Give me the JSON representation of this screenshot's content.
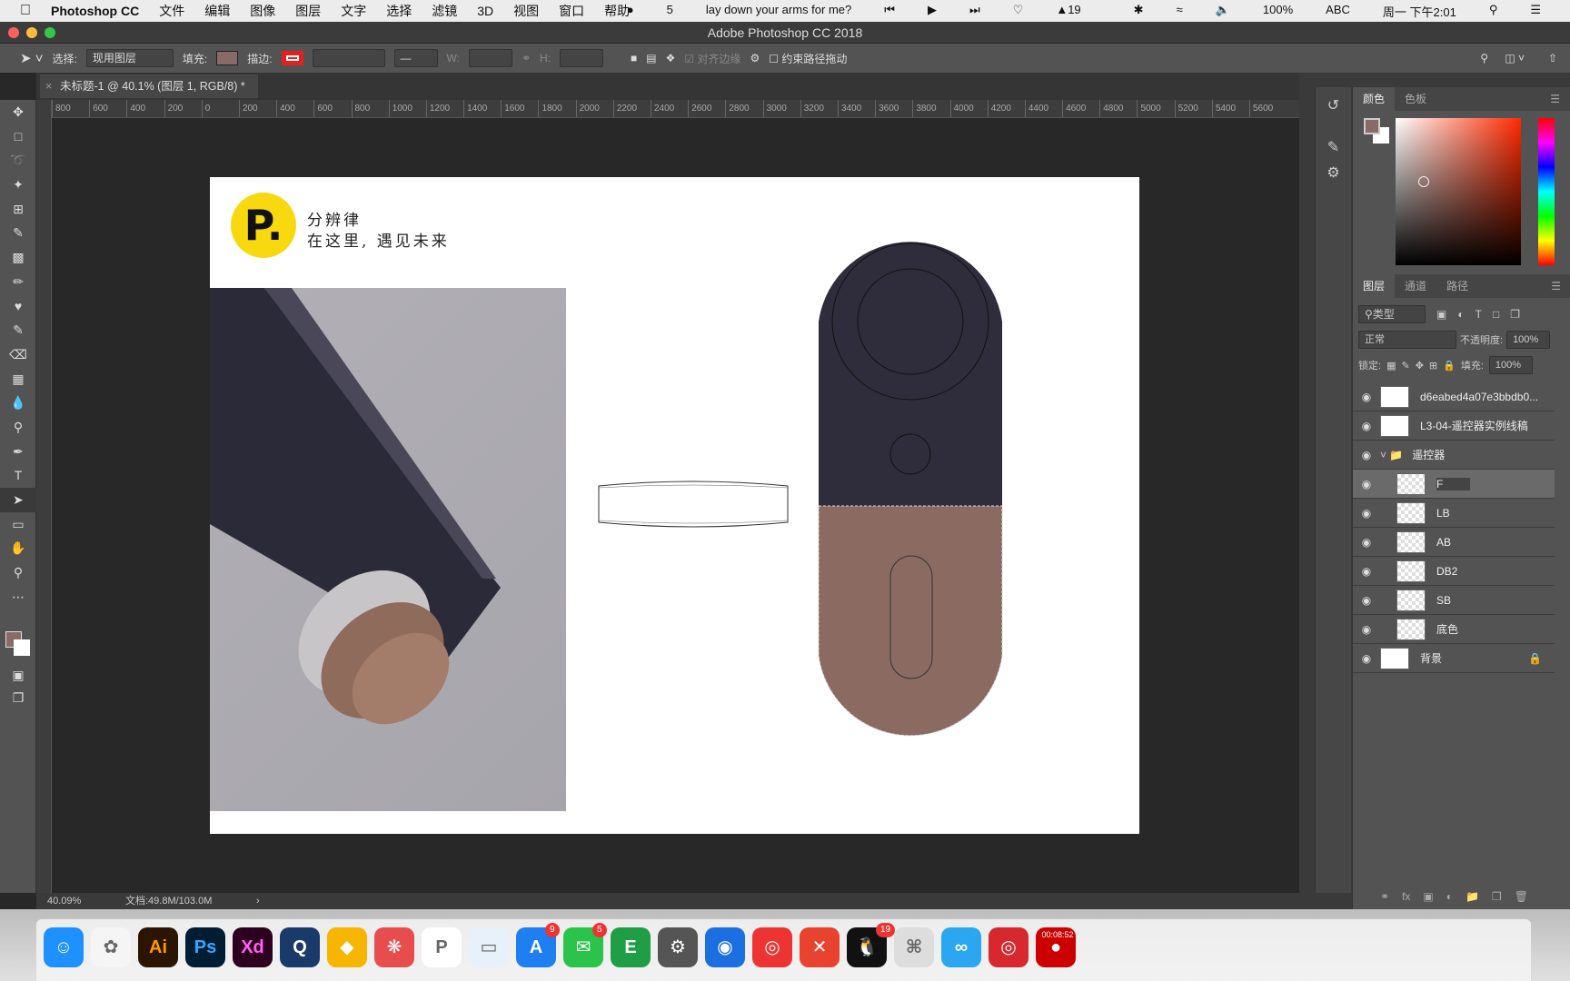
{
  "menubar": {
    "app": "Photoshop CC",
    "items": [
      "文件",
      "编辑",
      "图像",
      "图层",
      "文字",
      "选择",
      "滤镜",
      "3D",
      "视图",
      "窗口",
      "帮助"
    ],
    "wechat_count": "5",
    "song": "lay down your arms for me?",
    "notif_count": "19",
    "battery": "100%",
    "input": "ABC",
    "clock": "周一 下午2:01"
  },
  "window": {
    "title": "Adobe Photoshop CC 2018"
  },
  "options": {
    "select_label": "选择:",
    "select_value": "现用图层",
    "fill_label": "填充:",
    "stroke_label": "描边:",
    "w_label": "W:",
    "h_label": "H:",
    "align_edges": "对齐边缘",
    "constrain": "约束路径拖动",
    "fill_color": "#8a6a66",
    "stroke_color": "#e0211f"
  },
  "document": {
    "tab": "未标题-1 @ 40.1% (图层 1, RGB/8) *",
    "ruler": [
      "800",
      "600",
      "400",
      "200",
      "0",
      "200",
      "400",
      "600",
      "800",
      "1000",
      "1200",
      "1400",
      "1600",
      "1800",
      "2000",
      "2200",
      "2400",
      "2600",
      "2800",
      "3000",
      "3200",
      "3400",
      "3600",
      "3800",
      "4000",
      "4200",
      "4400",
      "4600",
      "4800",
      "5000",
      "5200",
      "5400",
      "5600"
    ],
    "logo_line1": "分辨律",
    "logo_line2": "在这里, 遇见未来",
    "logo_letter": "P."
  },
  "status": {
    "zoom": "40.09%",
    "doc": "文档:49.8M/103.0M"
  },
  "color_panel": {
    "tabs": [
      "颜色",
      "色板"
    ],
    "foreground": "#8a6a66",
    "background": "#ffffff"
  },
  "layers_panel": {
    "tabs": [
      "图层",
      "通道",
      "路径"
    ],
    "filter": "类型",
    "blend": "正常",
    "opacity_label": "不透明度:",
    "opacity": "100%",
    "lock_label": "锁定:",
    "fill_label": "填充:",
    "fill": "100%",
    "layers": [
      {
        "name": "d6eabed4a07e3bbdb0..."
      },
      {
        "name": "L3-04-遥控器实例线稿"
      },
      {
        "name": "遥控器",
        "group": true
      },
      {
        "name": "F",
        "selected": true
      },
      {
        "name": "LB"
      },
      {
        "name": "AB"
      },
      {
        "name": "DB2"
      },
      {
        "name": "SB"
      },
      {
        "name": "底色"
      },
      {
        "name": "背景",
        "locked": true
      }
    ]
  },
  "dock": {
    "apps": [
      "Finder",
      "Photos",
      "Ai",
      "Ps",
      "Xd",
      "QuickTime",
      "Sketch",
      "Klokki",
      "PicGo",
      "Keynote",
      "App Store",
      "WeChat",
      "Evernote",
      "System Preferences",
      "Safari",
      "Chrome",
      "XMind",
      "QQ",
      "Keystroke",
      "Xmind Zen",
      "NetEase Music",
      "Screen Recorder"
    ],
    "badges": {
      "appstore": "9",
      "wechat": "5",
      "qq": "19"
    },
    "recorder_time": "00:08:52"
  }
}
